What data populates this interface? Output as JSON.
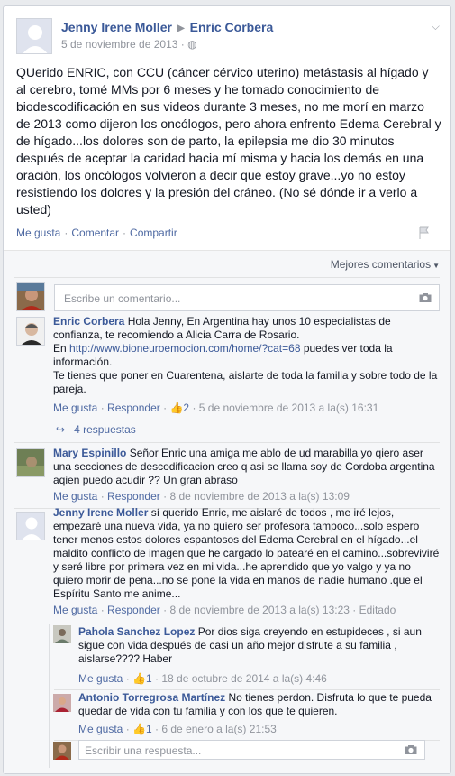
{
  "post": {
    "author": "Jenny Irene Moller",
    "target": "Enric Corbera",
    "date": "5 de noviembre de 2013",
    "text": "QUerido ENRIC, con CCU (cáncer cérvico uterino) metástasis al hígado y al cerebro, tomé MMs por 6 meses y he tomado conocimiento de biodescodificación en sus videos durante 3 meses, no me morí en marzo de 2013 como dijeron los oncólogos, pero ahora enfrento Edema Cerebral y de hígado...los dolores son de parto, la epilepsia me dio 30 minutos después de aceptar la caridad hacia mí misma y hacia los demás en una oración, los oncólogos volvieron a decir que estoy grave...yo no estoy resistiendo los dolores y la presión del cráneo. (No sé dónde ir a verlo a usted)",
    "actions": {
      "like": "Me gusta",
      "comment": "Comentar",
      "share": "Compartir"
    }
  },
  "comments_header": {
    "sort_label": "Mejores comentarios"
  },
  "comment_box": {
    "placeholder": "Escribe un comentario..."
  },
  "comments": [
    {
      "author": "Enric Corbera",
      "text_before_link": "Hola Jenny, En Argentina hay unos 10 especialistas de confianza, te recomiendo a Alicia Carra de Rosario.",
      "text_line2_prefix": "En ",
      "link": "http://www.bioneuroemocion.com/home/?cat=68",
      "text_after_link": " puedes ver toda la información.",
      "text_line3": "Te tienes que poner en Cuarentena, aislarte de toda la familia y sobre todo de la pareja.",
      "like": "Me gusta",
      "reply": "Responder",
      "likes": "2",
      "date": "5 de noviembre de 2013 a la(s) 16:31",
      "replies_label": "4 respuestas"
    },
    {
      "author": "Mary Espinillo",
      "text": "Señor Enric una amiga me ablo de ud marabilla yo qiero aser una secciones de descodificacion creo q asi se llama soy de Cordoba argentina aqien puedo acudir ?? Un gran abraso",
      "like": "Me gusta",
      "reply": "Responder",
      "date": "8 de noviembre de 2013 a la(s) 13:09"
    },
    {
      "author": "Jenny Irene Moller",
      "text": "sí querido Enric, me aislaré de todos , me iré lejos, empezaré una nueva vida, ya no quiero ser profesora tampoco...solo espero tener menos estos dolores espantosos del Edema Cerebral en el hígado...el maldito conflicto de imagen que he cargado lo patearé en el camino...sobreviviré y seré libre por primera vez en mi vida...he aprendido que yo valgo y ya no quiero morir de pena...no se pone la vida en manos de nadie humano .que el Espíritu Santo me anime...",
      "like": "Me gusta",
      "reply": "Responder",
      "date": "8 de noviembre de 2013 a la(s) 13:23",
      "edited": "Editado"
    }
  ],
  "replies": [
    {
      "author": "Pahola Sanchez Lopez",
      "text": "Por dios siga creyendo en estupideces , si aun sigue con vida después de casi un año mejor disfrute a su familia , aislarse???? Haber",
      "like": "Me gusta",
      "likes": "1",
      "date": "18 de octubre de 2014 a la(s) 4:46"
    },
    {
      "author": "Antonio Torregrosa Martínez",
      "text": "No tienes perdon. Disfruta lo que te pueda quedar de vida con tu familia y con los que te quieren.",
      "like": "Me gusta",
      "likes": "1",
      "date": "6 de enero a la(s) 21:53"
    }
  ],
  "reply_box": {
    "placeholder": "Escribir una respuesta..."
  },
  "icons": {
    "globe": "globe-icon",
    "chevron": "chevron-down-icon",
    "flag": "flag-icon",
    "camera": "camera-icon",
    "thumb": "thumbs-up-icon",
    "reply_arrow": "reply-arrow-icon"
  },
  "colors": {
    "link": "#3b5998",
    "meta": "#90949c",
    "background": "#e9ebee"
  }
}
